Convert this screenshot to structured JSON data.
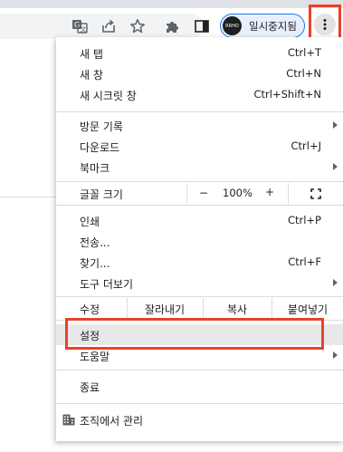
{
  "toolbar": {
    "icons": [
      "translate-icon",
      "share-icon",
      "bookmark-star-icon",
      "extensions-puzzle-icon",
      "side-panel-icon",
      "more-vert-icon"
    ],
    "profile": {
      "avatar_text": "RRHO",
      "name": "일시중지됨"
    }
  },
  "menu": {
    "new_tab": {
      "label": "새 탭",
      "shortcut": "Ctrl+T"
    },
    "new_window": {
      "label": "새 창",
      "shortcut": "Ctrl+N"
    },
    "new_incognito": {
      "label": "새 시크릿 창",
      "shortcut": "Ctrl+Shift+N"
    },
    "history": {
      "label": "방문 기록"
    },
    "downloads": {
      "label": "다운로드",
      "shortcut": "Ctrl+J"
    },
    "bookmarks": {
      "label": "북마크"
    },
    "zoom": {
      "label": "글꼴 크기",
      "minus": "−",
      "value": "100%",
      "plus": "+"
    },
    "print": {
      "label": "인쇄",
      "shortcut": "Ctrl+P"
    },
    "cast": {
      "label": "전송..."
    },
    "find": {
      "label": "찾기...",
      "shortcut": "Ctrl+F"
    },
    "more_tools": {
      "label": "도구 더보기"
    },
    "edit": {
      "label": "수정",
      "cut": "잘라내기",
      "copy": "복사",
      "paste": "붙여넣기"
    },
    "settings": {
      "label": "설정"
    },
    "help": {
      "label": "도움말"
    },
    "exit": {
      "label": "종료"
    },
    "managed": {
      "label": "조직에서 관리"
    }
  },
  "colors": {
    "highlight_annotation": "#e8412a",
    "profile_chip_border": "#1a73e8",
    "hover_row": "#e8e8e9"
  }
}
